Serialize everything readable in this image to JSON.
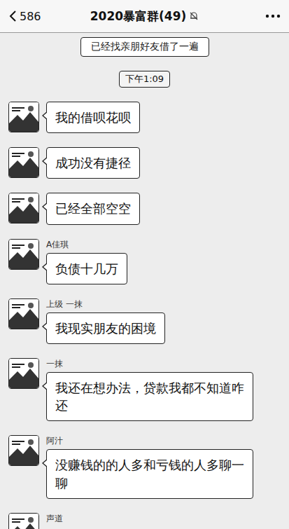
{
  "header": {
    "unread": "586",
    "title": "2020暴富群(49)",
    "muted": true
  },
  "notice": "已经找亲朋好友借了一遍",
  "time": "下午1:09",
  "messages": [
    {
      "name": "",
      "text": "我的借呗花呗"
    },
    {
      "name": "",
      "text": "成功没有捷径"
    },
    {
      "name": "",
      "text": "已经全部空空"
    },
    {
      "name": "A佳琪",
      "text": "负债十几万"
    },
    {
      "name": "上级 一抹",
      "text": "我现实朋友的困境"
    },
    {
      "name": "一抹",
      "text": "我还在想办法，贷款我都不知道咋还"
    },
    {
      "name": "阿汁",
      "text": "没赚钱的的人多和亏钱的人多聊一聊"
    }
  ],
  "partial_sender": {
    "name": "声道"
  }
}
